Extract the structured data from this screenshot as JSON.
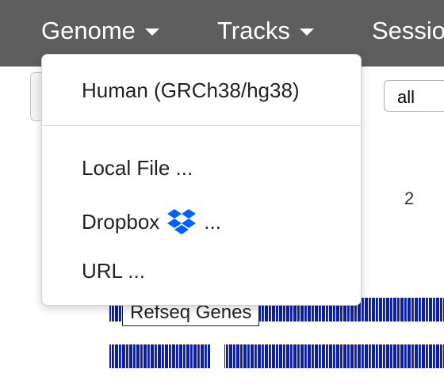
{
  "navbar": {
    "items": [
      {
        "label": "Genome"
      },
      {
        "label": "Tracks"
      },
      {
        "label": "Sessio"
      }
    ]
  },
  "toolbar": {
    "chromosome_select_value": "all"
  },
  "ruler": {
    "label": "2"
  },
  "tracks": {
    "gene_track_name": "Refseq Genes"
  },
  "genome_menu": {
    "items": [
      {
        "label": "Human (GRCh38/hg38)"
      },
      {
        "label": "Local File ..."
      },
      {
        "label": "Dropbox",
        "suffix": "...",
        "icon": "dropbox-icon"
      },
      {
        "label": "URL ..."
      }
    ]
  },
  "colors": {
    "navbar": "#5e5e5e",
    "track_blue": "#0d1fa0",
    "dropbox_blue": "#0061fe"
  }
}
